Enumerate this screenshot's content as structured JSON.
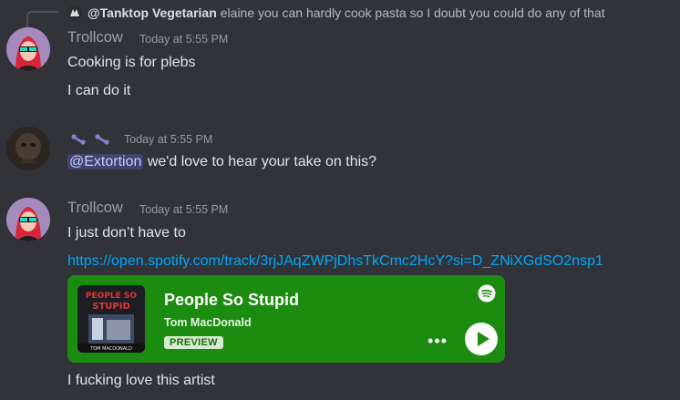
{
  "reply": {
    "username": "@Tanktop Vegetarian",
    "text": "elaine you can hardly cook pasta so I doubt you could do any of that"
  },
  "messages": [
    {
      "username": "Trollcow",
      "timestamp": "Today at 5:55 PM",
      "lines": [
        "Cooking is for plebs",
        "I can do it"
      ]
    },
    {
      "username": "",
      "timestamp": "Today at 5:55 PM",
      "mention": "@Extortion",
      "text": " we'd love to hear your take on this?"
    },
    {
      "username": "Trollcow",
      "timestamp": "Today at 5:55 PM",
      "line1": "I just don’t have to",
      "link": "https://open.spotify.com/track/3rjJAqZWPjDhsTkCmc2HcY?si=D_ZNiXGdSO2nsp1",
      "line2": "I fucking love this artist"
    }
  ],
  "embed": {
    "title": "People So Stupid",
    "artist": "Tom MacDonald",
    "badge": "PREVIEW",
    "more": "•••",
    "cover_text": "PEOPLE SO STUPID",
    "cover_credit": "TOM MACDONALD",
    "color": "#1b8c0f"
  },
  "icons": [
    "reply-avatar-icon",
    "avatar",
    "spotify-icon",
    "play-icon",
    "more-options-icon"
  ]
}
